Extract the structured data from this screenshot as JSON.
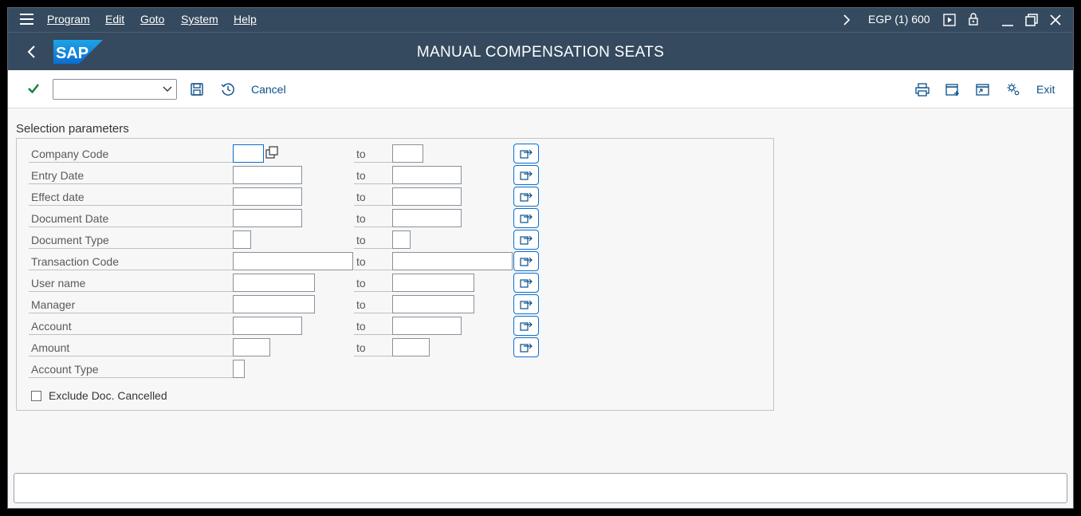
{
  "menubar": {
    "items": [
      {
        "label": "Program"
      },
      {
        "label": "Edit"
      },
      {
        "label": "Goto"
      },
      {
        "label": "System"
      },
      {
        "label": "Help"
      }
    ],
    "system_info": "EGP (1) 600",
    "icons": [
      "hamburger-icon",
      "chevron-right-icon",
      "play-icon",
      "lock-icon",
      "minimize-icon",
      "restore-icon",
      "close-icon"
    ]
  },
  "header": {
    "logo_text": "SAP",
    "title": "MANUAL COMPENSATION SEATS"
  },
  "toolbar": {
    "dropdown_value": "",
    "cancel_label": "Cancel",
    "exit_label": "Exit"
  },
  "selection": {
    "title": "Selection parameters",
    "to_label": "to",
    "rows": [
      {
        "label": "Company Code"
      },
      {
        "label": "Entry Date"
      },
      {
        "label": "Effect date"
      },
      {
        "label": "Document Date"
      },
      {
        "label": "Document Type"
      },
      {
        "label": "Transaction Code"
      },
      {
        "label": "User name"
      },
      {
        "label": "Manager"
      },
      {
        "label": "Account"
      },
      {
        "label": "Amount"
      },
      {
        "label": "Account Type"
      }
    ],
    "checkbox_label": "Exclude Doc. Cancelled",
    "checkbox_checked": false
  },
  "statusbar": {
    "text": ""
  },
  "colors": {
    "shell": "#354a5f",
    "accent": "#0a6ed1",
    "confirm_green": "#107e3e"
  }
}
